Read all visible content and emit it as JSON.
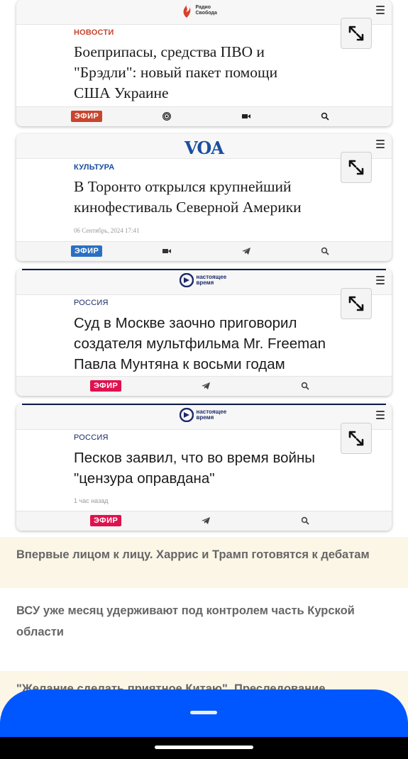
{
  "cards": [
    {
      "logo": "Радио Свобода",
      "category": "НОВОСТИ",
      "headline_lines": [
        "Боеприпасы, средства ПВО и",
        "\"Брэдли\": новый пакет помощи",
        "США Украине"
      ],
      "badge": "ЭФИР",
      "colors": {
        "category": "#c8452e",
        "badge": "#c8452e"
      }
    },
    {
      "logo": "VOA",
      "category": "КУЛЬТУРА",
      "headline_lines": [
        "В Торонто открылся крупнейший",
        "кинофестиваль Северной Америки"
      ],
      "date": "06 Сентябрь, 2024 17:41",
      "badge": "ЭФИР",
      "colors": {
        "category": "#1a4ea0",
        "badge": "#2a70c2"
      }
    },
    {
      "logo": "настоящее время",
      "category": "РОССИЯ",
      "headline_lines": [
        "Суд в Москве заочно приговорил",
        "создателя мультфильма Mr. Freeman",
        "Павла Мунтяна к восьми годам"
      ],
      "badge": "ЭФИР",
      "colors": {
        "category": "#1c2a6b",
        "badge": "#e0114f"
      }
    },
    {
      "logo": "настоящее время",
      "category": "РОССИЯ",
      "headline_lines": [
        "Песков заявил, что во время войны",
        "\"цензура оправдана\""
      ],
      "date": "1 час назад",
      "badge": "ЭФИР",
      "colors": {
        "category": "#1c2a6b",
        "badge": "#e0114f"
      }
    }
  ],
  "list": [
    {
      "text": "Впервые лицом к лицу. Харрис и Трамп готовятся к дебатам",
      "bg": "#fbf6e6"
    },
    {
      "text": "ВСУ уже месяц удерживают под контролем часть Курской области",
      "bg": "#ffffff"
    },
    {
      "text": "\"Желание сделать приятное Китаю\". Преследование",
      "bg": "#fbf6e6"
    }
  ],
  "icons": {
    "menu": "menu-icon",
    "expand": "expand-icon",
    "search": "search-icon",
    "video": "video-icon",
    "podcast": "podcast-icon",
    "telegram": "telegram-icon"
  }
}
